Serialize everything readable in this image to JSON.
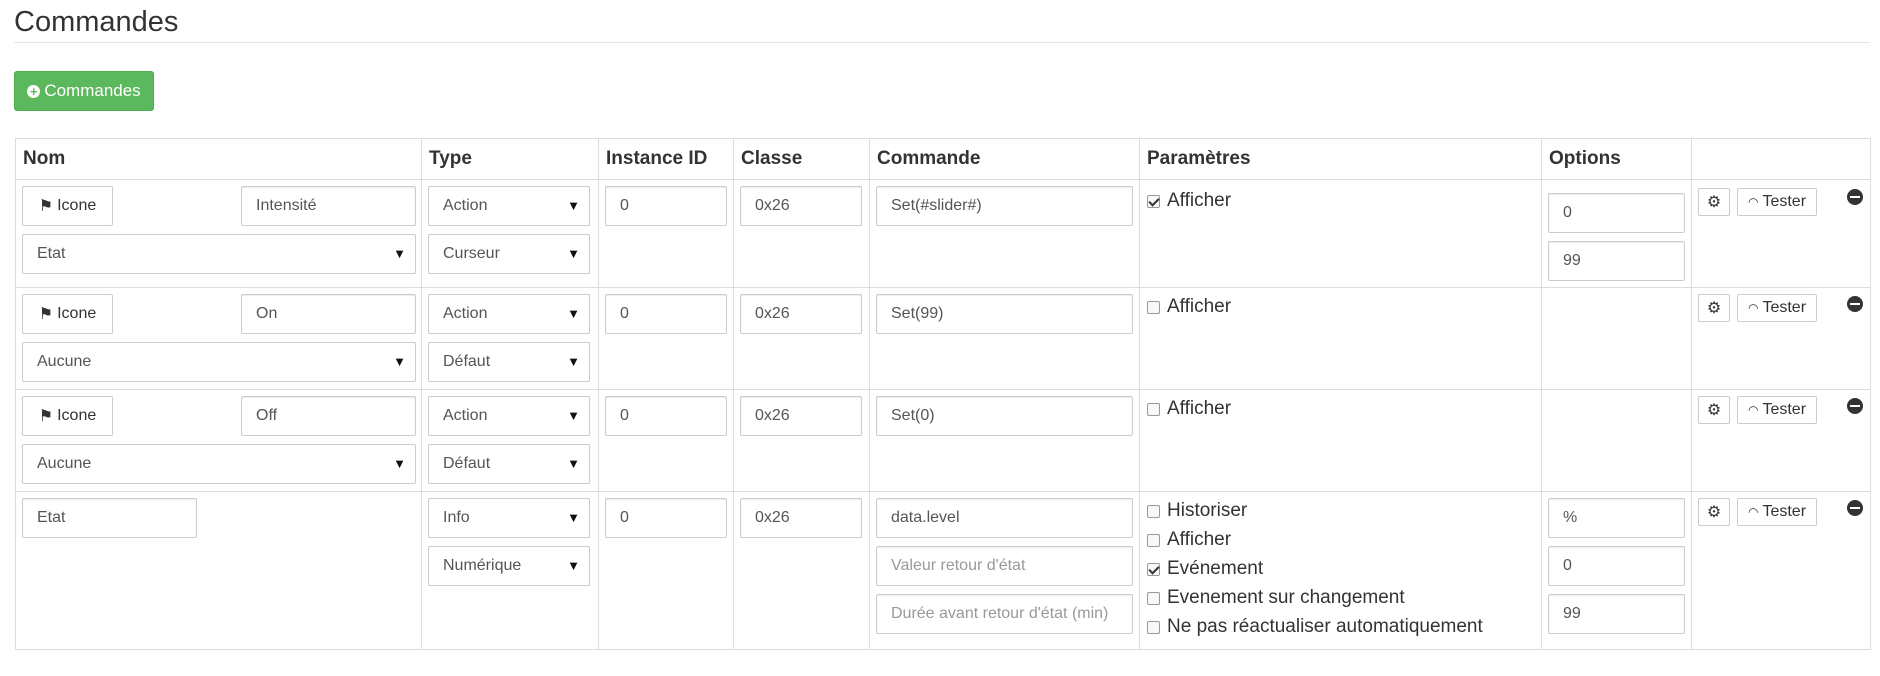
{
  "page": {
    "title": "Commandes",
    "add_button": "Commandes"
  },
  "headers": [
    "Nom",
    "Type",
    "Instance ID",
    "Classe",
    "Commande",
    "Paramètres",
    "Options",
    ""
  ],
  "labels": {
    "icon_button": "Icone",
    "test_button": "Tester"
  },
  "rows": [
    {
      "name": "Intensité",
      "value_select": "Etat",
      "type": "Action",
      "subtype": "Curseur",
      "instance": "0",
      "classe": "0x26",
      "commande": "Set(#slider#)",
      "params": [
        {
          "label": "Afficher",
          "checked": true
        }
      ],
      "options": [
        "0",
        "99"
      ]
    },
    {
      "name": "On",
      "value_select": "Aucune",
      "type": "Action",
      "subtype": "Défaut",
      "instance": "0",
      "classe": "0x26",
      "commande": "Set(99)",
      "params": [
        {
          "label": "Afficher",
          "checked": false
        }
      ],
      "options": []
    },
    {
      "name": "Off",
      "value_select": "Aucune",
      "type": "Action",
      "subtype": "Défaut",
      "instance": "0",
      "classe": "0x26",
      "commande": "Set(0)",
      "params": [
        {
          "label": "Afficher",
          "checked": false
        }
      ],
      "options": []
    },
    {
      "name": "Etat",
      "type": "Info",
      "subtype": "Numérique",
      "instance": "0",
      "classe": "0x26",
      "commande": "data.level",
      "return_value_placeholder": "Valeur retour d'état",
      "return_delay_placeholder": "Durée avant retour d'état (min)",
      "params": [
        {
          "label": "Historiser",
          "checked": false
        },
        {
          "label": "Afficher",
          "checked": false
        },
        {
          "label": "Evénement",
          "checked": true
        },
        {
          "label": "Evenement sur changement",
          "checked": false
        },
        {
          "label": "Ne pas réactualiser automatiquement",
          "checked": false
        }
      ],
      "options": [
        "%",
        "0",
        "99"
      ]
    }
  ],
  "icons": {
    "add": "plus-circle-icon",
    "icon_button": "flag-icon",
    "config": "gears-icon",
    "test": "rss-icon",
    "remove": "minus-circle-icon",
    "dropdown": "caret-down-icon"
  },
  "colors": {
    "success": "#5cb85c",
    "border": "#dddddd"
  }
}
